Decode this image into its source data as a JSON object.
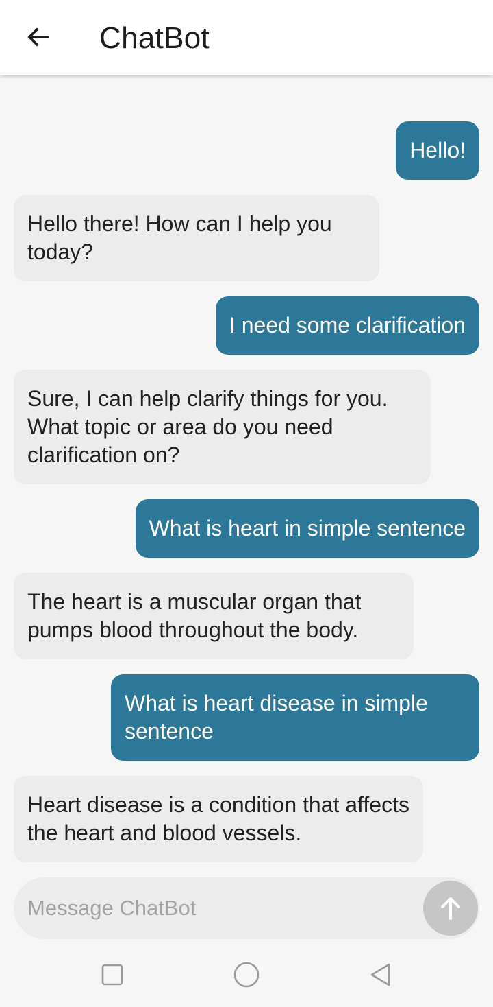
{
  "app_bar": {
    "title": "ChatBot",
    "back_icon": "arrow-left-icon"
  },
  "messages": [
    {
      "role": "user",
      "text": "Hello!"
    },
    {
      "role": "bot",
      "text": "Hello there! How can I help you today?"
    },
    {
      "role": "user",
      "text": "I need some clarification"
    },
    {
      "role": "bot",
      "text": "Sure, I can help clarify things for you. What topic or area do you need clarification on?"
    },
    {
      "role": "user",
      "text": "What is heart in simple sentence"
    },
    {
      "role": "bot",
      "text": "The heart is a muscular organ that pumps blood throughout the body."
    },
    {
      "role": "user",
      "text": "What is heart disease in simple sentence"
    },
    {
      "role": "bot",
      "text": "Heart disease is a condition that affects the heart and blood vessels."
    }
  ],
  "composer": {
    "placeholder": "Message ChatBot",
    "value": "",
    "send_icon": "arrow-up-icon"
  },
  "system_nav": {
    "recents_icon": "square-icon",
    "home_icon": "circle-icon",
    "back_icon": "triangle-back-icon"
  },
  "colors": {
    "user_bubble": "#2d7899",
    "bot_bubble": "#ececec",
    "background": "#f6f6f6"
  }
}
